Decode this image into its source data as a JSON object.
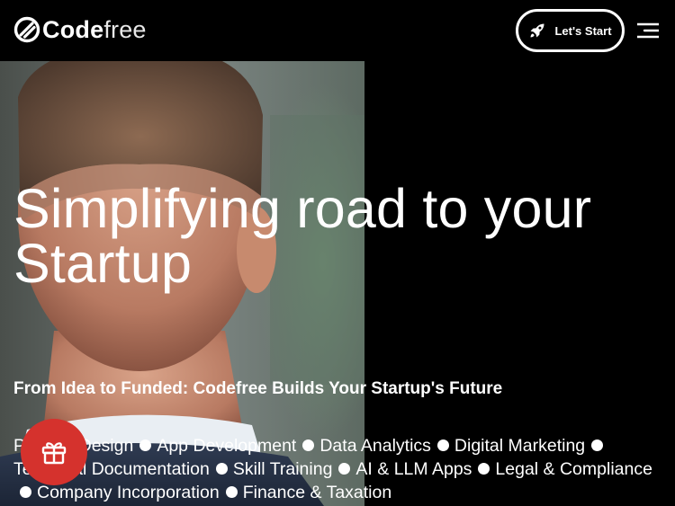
{
  "header": {
    "logo": {
      "bold": "Code",
      "light": "free"
    },
    "cta_label": "Let's Start",
    "cta_icon": "rocket-icon",
    "menu_icon": "menu-icon"
  },
  "hero": {
    "headline": "Simplifying road to your Startup",
    "subheadline": "From Idea to Funded: Codefree Builds Your Startup's Future",
    "services": [
      "Product Design",
      "App Development",
      "Data Analytics",
      "Digital Marketing",
      "Technical Documentation",
      "Skill Training",
      "AI & LLM Apps",
      "Legal & Compliance",
      "Company Incorporation",
      "Finance & Taxation"
    ]
  },
  "floating": {
    "gift_icon": "gift-icon",
    "color": "#d5322d"
  },
  "colors": {
    "background": "#000000",
    "text": "#ffffff",
    "accent": "#d5322d"
  }
}
